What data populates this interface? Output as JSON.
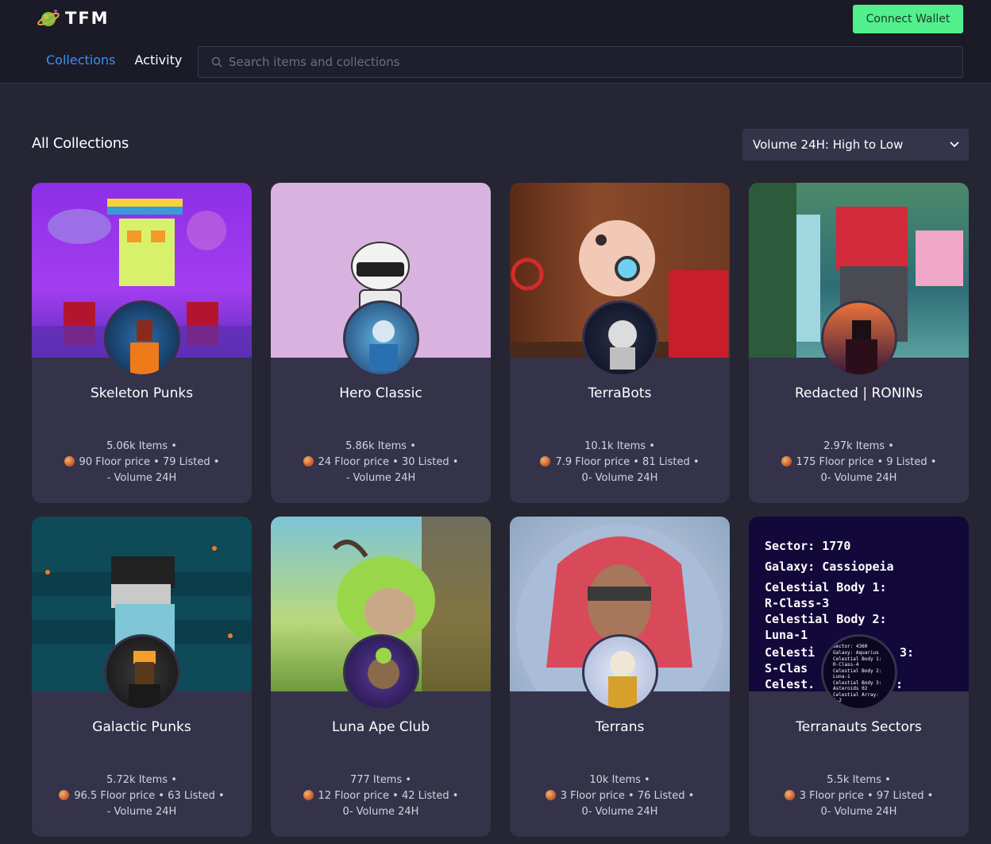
{
  "header": {
    "logo_text": "TFM",
    "connect_label": "Connect Wallet",
    "nav": [
      {
        "label": "Collections",
        "active": true
      },
      {
        "label": "Activity",
        "active": false
      }
    ],
    "search_placeholder": "Search items and collections"
  },
  "main": {
    "title": "All Collections",
    "sort_label": "Volume 24H: High to Low"
  },
  "collections": [
    {
      "name": "Skeleton Punks",
      "line1": "5.06k Items •",
      "line2": "90 Floor price • 79 Listed •",
      "line3": "- Volume 24H"
    },
    {
      "name": "Hero Classic",
      "line1": "5.86k Items •",
      "line2": "24 Floor price • 30 Listed •",
      "line3": "- Volume 24H"
    },
    {
      "name": "TerraBots",
      "line1": "10.1k Items •",
      "line2": "7.9 Floor price • 81 Listed •",
      "line3": "0- Volume 24H"
    },
    {
      "name": "Redacted | RONINs",
      "line1": "2.97k Items •",
      "line2": "175 Floor price • 9 Listed •",
      "line3": "0- Volume 24H"
    },
    {
      "name": "Galactic Punks",
      "line1": "5.72k Items •",
      "line2": "96.5 Floor price • 63 Listed •",
      "line3": "- Volume 24H"
    },
    {
      "name": "Luna Ape Club",
      "line1": "777 Items •",
      "line2": "12 Floor price • 42 Listed •",
      "line3": "0- Volume 24H"
    },
    {
      "name": "Terrans",
      "line1": "10k Items •",
      "line2": "3 Floor price • 76 Listed •",
      "line3": "0- Volume 24H"
    },
    {
      "name": "Terranauts Sectors",
      "line1": "5.5k Items •",
      "line2": "3 Floor price • 97 Listed •",
      "line3": "0- Volume 24H"
    }
  ],
  "sectors_banner": {
    "lines": [
      "Sector: 1770",
      "Galaxy: Cassiopeia",
      "Celestial Body 1:",
      "R-Class-3",
      "Celestial Body 2:",
      "Luna-1",
      "Celesti",
      "3:",
      "S-Clas",
      "Celest.",
      ":"
    ],
    "avatar_lines": [
      "Sector: 4360",
      "Galaxy: Aquarius",
      "Celestial Body 1:",
      "R-Class-4",
      "Celestial Body 2:",
      "Luna-1",
      "Celestial Body 3:",
      "Asteroids 02",
      "Celestial Array:",
      "I-2"
    ]
  },
  "colors": {
    "accent_green": "#52f08c",
    "active_link": "#3d8ff2",
    "card_bg": "#34334a",
    "page_bg": "#262534"
  }
}
